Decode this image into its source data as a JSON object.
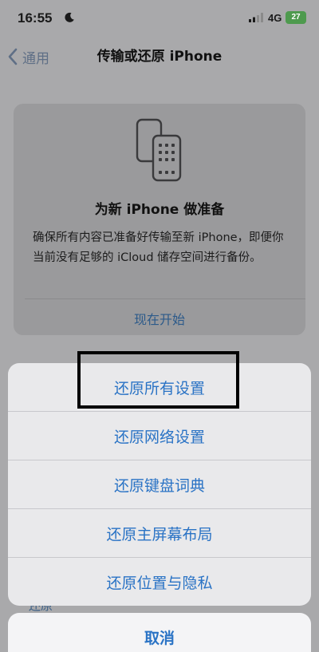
{
  "status_bar": {
    "time": "16:55",
    "network": "4G",
    "battery": "27"
  },
  "nav": {
    "back_label": "通用",
    "title": "传输或还原 iPhone"
  },
  "card": {
    "title": "为新 iPhone 做准备",
    "description": "确保所有内容已准备好传输至新 iPhone，即便你当前没有足够的 iCloud 储存空间进行备份。",
    "action": "现在开始"
  },
  "peek_label": "还原",
  "action_sheet": {
    "items": [
      {
        "label": "还原所有设置"
      },
      {
        "label": "还原网络设置"
      },
      {
        "label": "还原键盘词典"
      },
      {
        "label": "还原主屏幕布局"
      },
      {
        "label": "还原位置与隐私"
      }
    ],
    "cancel": "取消"
  },
  "colors": {
    "dimmed_background": "#a9a9ab",
    "action_blue": "#2a73c5",
    "battery_green": "#4e9a4e"
  }
}
